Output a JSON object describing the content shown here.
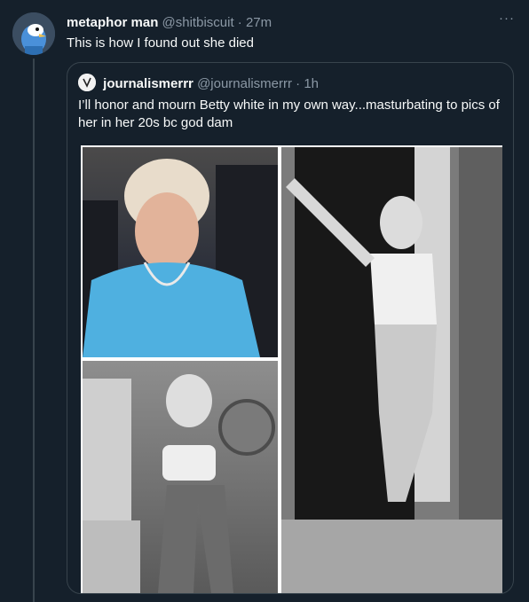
{
  "tweet": {
    "name": "metaphor man",
    "handle": "@shitbiscuit",
    "separator": "·",
    "time": "27m",
    "more": "···",
    "text": "This is how I found out she died"
  },
  "quote": {
    "name": "journalismerrr",
    "handle": "@journalismerrr",
    "separator": "·",
    "time": "1h",
    "text": "I’ll honor and mourn Betty white in my own way...masturbating to pics of her in her 20s bc god dam"
  },
  "colors": {
    "background": "#15202b",
    "border": "#38444d",
    "secondary_text": "#8b98a5"
  }
}
